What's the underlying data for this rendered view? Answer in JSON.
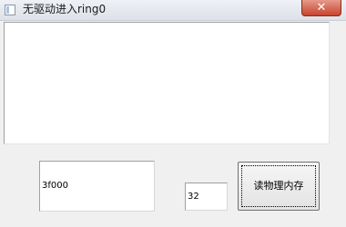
{
  "window": {
    "title": "无驱动进入ring0",
    "close_glyph": "✕"
  },
  "form": {
    "address_value": "3f000",
    "length_value": "32",
    "read_button_label": "读物理内存"
  }
}
